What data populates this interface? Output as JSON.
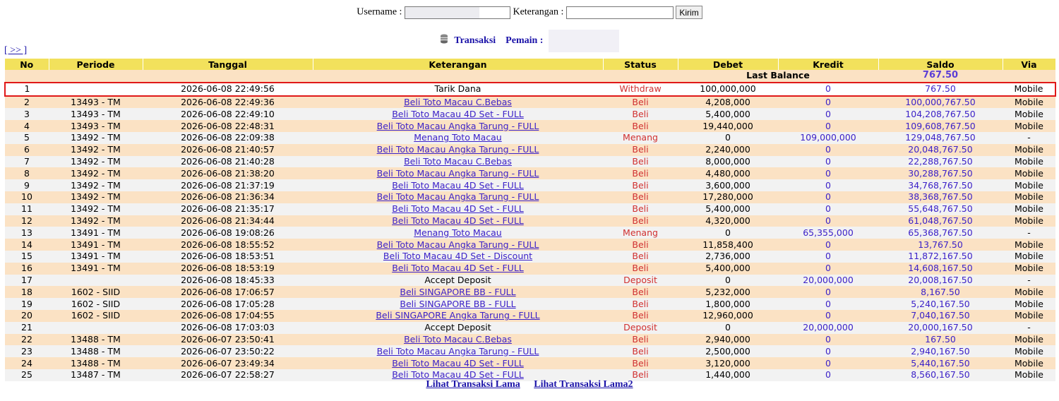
{
  "form": {
    "username_label": "Username :",
    "username_value": "",
    "keterangan_label": "Keterangan :",
    "keterangan_value": "",
    "submit_label": "Kirim"
  },
  "subtitle": {
    "transaksi": "Transaksi",
    "pemain": "Pemain :"
  },
  "nav": {
    "next": "[ >> ]"
  },
  "table": {
    "headers": [
      "No",
      "Periode",
      "Tanggal",
      "Keterangan",
      "Status",
      "Debet",
      "Kredit",
      "Saldo",
      "Via"
    ],
    "last_balance_label": "Last Balance",
    "last_balance_value": "767.50",
    "rows": [
      {
        "no": "1",
        "periode": "",
        "tanggal": "2026-06-08 22:49:56",
        "ket": "Tarik Dana",
        "link": false,
        "status": "Withdraw",
        "debet": "100,000,000",
        "kredit": "0",
        "saldo": "767.50",
        "via": "Mobile"
      },
      {
        "no": "2",
        "periode": "13493 - TM",
        "tanggal": "2026-06-08 22:49:36",
        "ket": "Beli Toto Macau C.Bebas",
        "link": true,
        "status": "Beli",
        "debet": "4,208,000",
        "kredit": "0",
        "saldo": "100,000,767.50",
        "via": "Mobile"
      },
      {
        "no": "3",
        "periode": "13493 - TM",
        "tanggal": "2026-06-08 22:49:10",
        "ket": "Beli Toto Macau 4D Set - FULL",
        "link": true,
        "status": "Beli",
        "debet": "5,400,000",
        "kredit": "0",
        "saldo": "104,208,767.50",
        "via": "Mobile"
      },
      {
        "no": "4",
        "periode": "13493 - TM",
        "tanggal": "2026-06-08 22:48:31",
        "ket": "Beli Toto Macau Angka Tarung - FULL",
        "link": true,
        "status": "Beli",
        "debet": "19,440,000",
        "kredit": "0",
        "saldo": "109,608,767.50",
        "via": "Mobile"
      },
      {
        "no": "5",
        "periode": "13492 - TM",
        "tanggal": "2026-06-08 22:09:38",
        "ket": "Menang Toto Macau",
        "link": true,
        "status": "Menang",
        "debet": "0",
        "kredit": "109,000,000",
        "saldo": "129,048,767.50",
        "via": "-"
      },
      {
        "no": "6",
        "periode": "13492 - TM",
        "tanggal": "2026-06-08 21:40:57",
        "ket": "Beli Toto Macau Angka Tarung - FULL",
        "link": true,
        "status": "Beli",
        "debet": "2,240,000",
        "kredit": "0",
        "saldo": "20,048,767.50",
        "via": "Mobile"
      },
      {
        "no": "7",
        "periode": "13492 - TM",
        "tanggal": "2026-06-08 21:40:28",
        "ket": "Beli Toto Macau C.Bebas",
        "link": true,
        "status": "Beli",
        "debet": "8,000,000",
        "kredit": "0",
        "saldo": "22,288,767.50",
        "via": "Mobile"
      },
      {
        "no": "8",
        "periode": "13492 - TM",
        "tanggal": "2026-06-08 21:38:20",
        "ket": "Beli Toto Macau Angka Tarung - FULL",
        "link": true,
        "status": "Beli",
        "debet": "4,480,000",
        "kredit": "0",
        "saldo": "30,288,767.50",
        "via": "Mobile"
      },
      {
        "no": "9",
        "periode": "13492 - TM",
        "tanggal": "2026-06-08 21:37:19",
        "ket": "Beli Toto Macau 4D Set - FULL",
        "link": true,
        "status": "Beli",
        "debet": "3,600,000",
        "kredit": "0",
        "saldo": "34,768,767.50",
        "via": "Mobile"
      },
      {
        "no": "10",
        "periode": "13492 - TM",
        "tanggal": "2026-06-08 21:36:34",
        "ket": "Beli Toto Macau Angka Tarung - FULL",
        "link": true,
        "status": "Beli",
        "debet": "17,280,000",
        "kredit": "0",
        "saldo": "38,368,767.50",
        "via": "Mobile"
      },
      {
        "no": "11",
        "periode": "13492 - TM",
        "tanggal": "2026-06-08 21:35:17",
        "ket": "Beli Toto Macau 4D Set - FULL",
        "link": true,
        "status": "Beli",
        "debet": "5,400,000",
        "kredit": "0",
        "saldo": "55,648,767.50",
        "via": "Mobile"
      },
      {
        "no": "12",
        "periode": "13492 - TM",
        "tanggal": "2026-06-08 21:34:44",
        "ket": "Beli Toto Macau 4D Set - FULL",
        "link": true,
        "status": "Beli",
        "debet": "4,320,000",
        "kredit": "0",
        "saldo": "61,048,767.50",
        "via": "Mobile"
      },
      {
        "no": "13",
        "periode": "13491 - TM",
        "tanggal": "2026-06-08 19:08:26",
        "ket": "Menang Toto Macau",
        "link": true,
        "status": "Menang",
        "debet": "0",
        "kredit": "65,355,000",
        "saldo": "65,368,767.50",
        "via": "-"
      },
      {
        "no": "14",
        "periode": "13491 - TM",
        "tanggal": "2026-06-08 18:55:52",
        "ket": "Beli Toto Macau Angka Tarung - FULL",
        "link": true,
        "status": "Beli",
        "debet": "11,858,400",
        "kredit": "0",
        "saldo": "13,767.50",
        "via": "Mobile"
      },
      {
        "no": "15",
        "periode": "13491 - TM",
        "tanggal": "2026-06-08 18:53:51",
        "ket": "Beli Toto Macau 4D Set - Discount",
        "link": true,
        "status": "Beli",
        "debet": "2,736,000",
        "kredit": "0",
        "saldo": "11,872,167.50",
        "via": "Mobile"
      },
      {
        "no": "16",
        "periode": "13491 - TM",
        "tanggal": "2026-06-08 18:53:19",
        "ket": "Beli Toto Macau 4D Set - FULL",
        "link": true,
        "status": "Beli",
        "debet": "5,400,000",
        "kredit": "0",
        "saldo": "14,608,167.50",
        "via": "Mobile"
      },
      {
        "no": "17",
        "periode": "",
        "tanggal": "2026-06-08 18:45:33",
        "ket": "Accept Deposit",
        "link": false,
        "status": "Deposit",
        "debet": "0",
        "kredit": "20,000,000",
        "saldo": "20,008,167.50",
        "via": "-"
      },
      {
        "no": "18",
        "periode": "1602 - SIID",
        "tanggal": "2026-06-08 17:06:57",
        "ket": "Beli SINGAPORE BB - FULL",
        "link": true,
        "status": "Beli",
        "debet": "5,232,000",
        "kredit": "0",
        "saldo": "8,167.50",
        "via": "Mobile"
      },
      {
        "no": "19",
        "periode": "1602 - SIID",
        "tanggal": "2026-06-08 17:05:28",
        "ket": "Beli SINGAPORE BB - FULL",
        "link": true,
        "status": "Beli",
        "debet": "1,800,000",
        "kredit": "0",
        "saldo": "5,240,167.50",
        "via": "Mobile"
      },
      {
        "no": "20",
        "periode": "1602 - SIID",
        "tanggal": "2026-06-08 17:04:55",
        "ket": "Beli SINGAPORE Angka Tarung - FULL",
        "link": true,
        "status": "Beli",
        "debet": "12,960,000",
        "kredit": "0",
        "saldo": "7,040,167.50",
        "via": "Mobile"
      },
      {
        "no": "21",
        "periode": "",
        "tanggal": "2026-06-08 17:03:03",
        "ket": "Accept Deposit",
        "link": false,
        "status": "Deposit",
        "debet": "0",
        "kredit": "20,000,000",
        "saldo": "20,000,167.50",
        "via": "-"
      },
      {
        "no": "22",
        "periode": "13488 - TM",
        "tanggal": "2026-06-07 23:50:41",
        "ket": "Beli Toto Macau C.Bebas",
        "link": true,
        "status": "Beli",
        "debet": "2,940,000",
        "kredit": "0",
        "saldo": "167.50",
        "via": "Mobile"
      },
      {
        "no": "23",
        "periode": "13488 - TM",
        "tanggal": "2026-06-07 23:50:22",
        "ket": "Beli Toto Macau Angka Tarung - FULL",
        "link": true,
        "status": "Beli",
        "debet": "2,500,000",
        "kredit": "0",
        "saldo": "2,940,167.50",
        "via": "Mobile"
      },
      {
        "no": "24",
        "periode": "13488 - TM",
        "tanggal": "2026-06-07 23:49:34",
        "ket": "Beli Toto Macau 4D Set - FULL",
        "link": true,
        "status": "Beli",
        "debet": "3,120,000",
        "kredit": "0",
        "saldo": "5,440,167.50",
        "via": "Mobile"
      },
      {
        "no": "25",
        "periode": "13487 - TM",
        "tanggal": "2026-06-07 22:58:27",
        "ket": "Beli Toto Macau 4D Set - FULL",
        "link": true,
        "status": "Beli",
        "debet": "1,440,000",
        "kredit": "0",
        "saldo": "8,560,167.50",
        "via": "Mobile"
      }
    ]
  },
  "footer": {
    "link1": "Lihat Transaksi Lama",
    "link2": "Lihat Transaksi Lama2"
  },
  "colors": {
    "header_bg": "#f2e15c",
    "row_odd": "#f2f2f2",
    "row_even": "#fbe2c4",
    "link": "#3c22c8",
    "status": "#d03030",
    "highlight_border": "#e01818"
  },
  "icons": {
    "subtitle_icon": "database-icon"
  }
}
